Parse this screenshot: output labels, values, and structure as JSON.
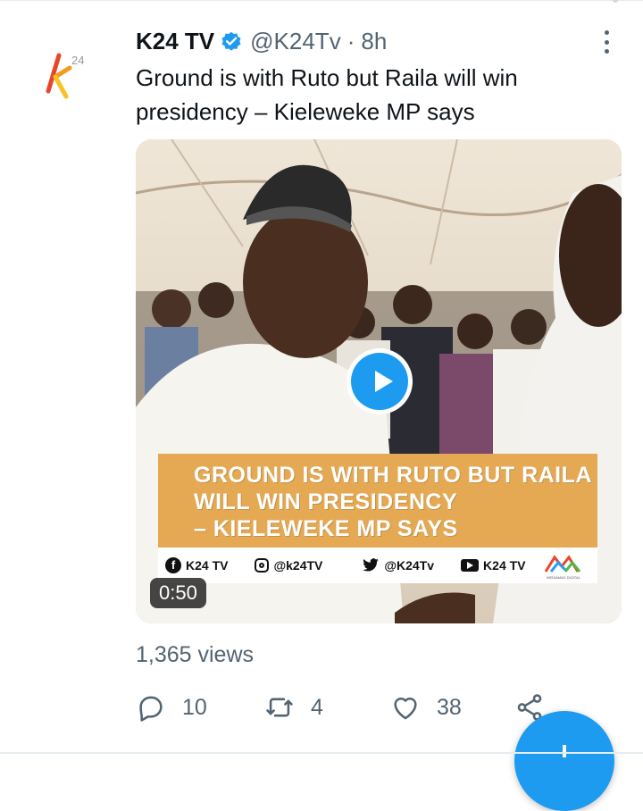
{
  "tweet": {
    "author_name": "K24 TV",
    "handle": "@K24Tv",
    "separator": "·",
    "time": "8h",
    "verified": true,
    "text": "Ground is with Ruto but Raila will win presidency – Kieleweke MP says",
    "avatar_text": "24"
  },
  "media": {
    "type": "video",
    "duration": "0:50",
    "banner_lines": [
      "GROUND IS WITH RUTO BUT RAILA",
      "WILL WIN PRESIDENCY",
      "– KIELEWEKE MP SAYS"
    ],
    "social": [
      {
        "icon": "facebook-icon",
        "label": "K24 TV"
      },
      {
        "icon": "instagram-icon",
        "label": "@k24TV"
      },
      {
        "icon": "twitter-icon",
        "label": "@K24Tv"
      },
      {
        "icon": "youtube-icon",
        "label": "K24 TV"
      }
    ],
    "brand_text": "MEDIAMAX DIGITAL"
  },
  "stats": {
    "views": "1,365 views",
    "replies": "10",
    "retweets": "4",
    "likes": "38"
  },
  "colors": {
    "accent": "#1d9bf0",
    "text_primary": "#0f1419",
    "text_secondary": "#536471",
    "banner": "#e5a953"
  }
}
